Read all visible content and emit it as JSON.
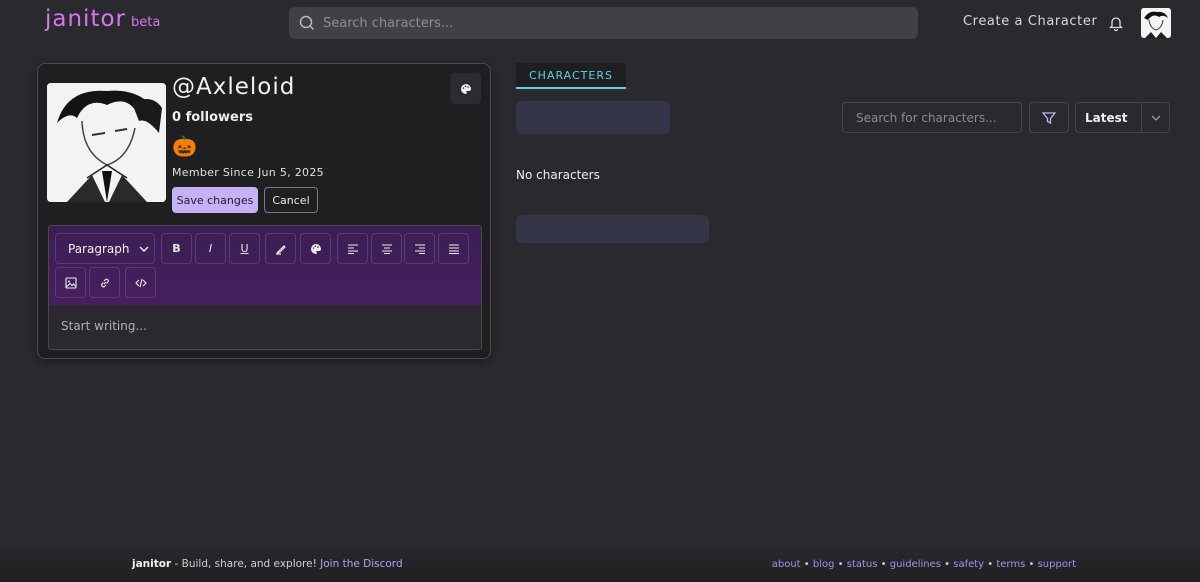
{
  "header": {
    "logo": "janitor",
    "beta": "beta",
    "search_placeholder": "Search characters...",
    "create_link": "Create a Character"
  },
  "profile": {
    "username": "@Axleloid",
    "followers": "0 followers",
    "emoji": "🎃",
    "member_since": "Member Since Jun 5, 2025",
    "save_label": "Save changes",
    "cancel_label": "Cancel"
  },
  "editor": {
    "block_type": "Paragraph",
    "bold": "B",
    "italic": "I",
    "underline": "U",
    "placeholder": "Start writing..."
  },
  "characters": {
    "tab_label": "CHARACTERS",
    "search_placeholder": "Search for characters...",
    "sort_value": "Latest",
    "empty_text": "No characters"
  },
  "footer": {
    "brand": "janitor",
    "tagline": " - Build, share, and explore! ",
    "discord": "Join the Discord",
    "links": [
      "about",
      "blog",
      "status",
      "guidelines",
      "safety",
      "terms",
      "support"
    ]
  },
  "colors": {
    "brand": "#d577ee",
    "accent_tab": "#5ad4e6",
    "save_button": "#c5b1f5",
    "toolbar": "#46205e"
  }
}
